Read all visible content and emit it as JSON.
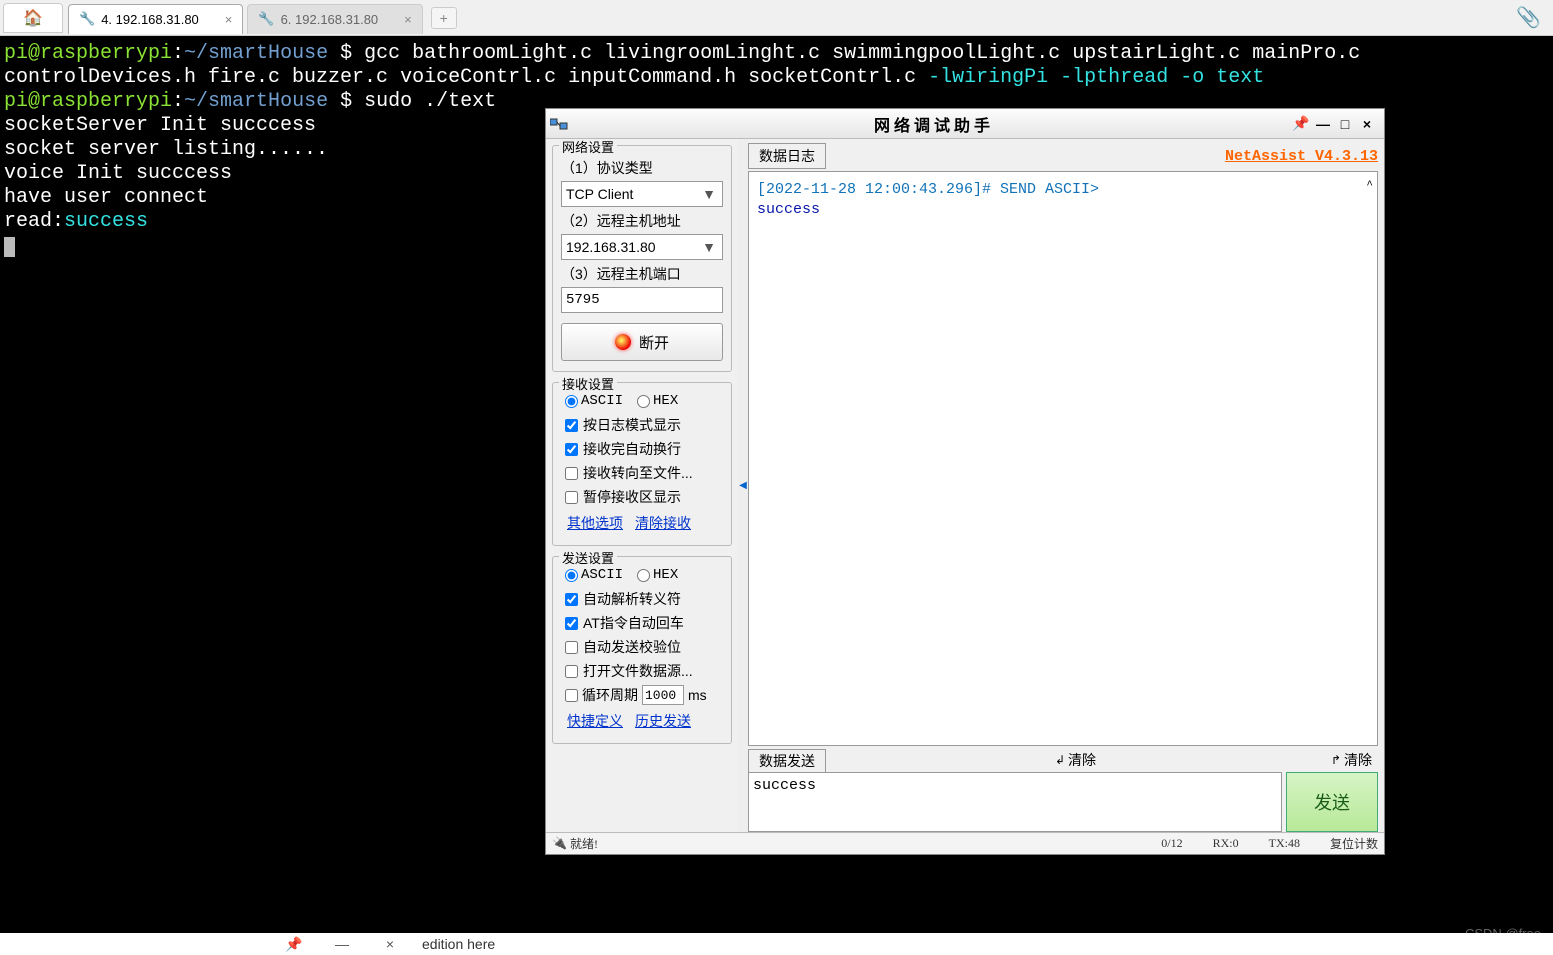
{
  "tabs": {
    "home_icon": "🏠",
    "tab1_icon": "🔧",
    "tab1_label": "4. 192.168.31.80",
    "tab1_close": "×",
    "tab2_icon": "🔧",
    "tab2_label": "6. 192.168.31.80",
    "tab2_close": "×",
    "plus": "+",
    "paperclip": "📎"
  },
  "terminal": {
    "prompt_user": "pi@raspberrypi",
    "prompt_sep": ":",
    "prompt_path": "~/smartHouse",
    "prompt_end": " $ ",
    "cmd1": "gcc bathroomLight.c livingroomLinght.c swimmingpoolLight.c upstairLight.c mainPro.c controlDevices.h fire.c buzzer.c voiceContrl.c inputCommand.h socketContrl.c ",
    "cmd1_flags": "-lwiringPi -lpthread  -o text",
    "cmd2": "sudo ./text",
    "out1": "socketServer Init succcess",
    "out2": "socket server listing......",
    "out3": "voice Init succcess",
    "out4": "have user connect",
    "out5_a": "read:",
    "out5_b": "success"
  },
  "netassist": {
    "title": "网络调试助手",
    "version": "NetAssist V4.3.13",
    "group_net": "网络设置",
    "label_protocol": "（1）协议类型",
    "select_protocol": "TCP Client",
    "label_host": "（2）远程主机地址",
    "input_host": "192.168.31.80",
    "label_port": "（3）远程主机端口",
    "input_port": "5795",
    "btn_disconnect": "断开",
    "group_recv": "接收设置",
    "radio_ascii": "ASCII",
    "radio_hex": "HEX",
    "chk_logmode": "按日志模式显示",
    "chk_autowrap": "接收完自动换行",
    "chk_tofile": "接收转向至文件...",
    "chk_pause": "暂停接收区显示",
    "link_other": "其他选项",
    "link_clear_recv": "清除接收",
    "group_send": "发送设置",
    "chk_escape": "自动解析转义符",
    "chk_at": "AT指令自动回车",
    "chk_checksum": "自动发送校验位",
    "chk_openfile": "打开文件数据源...",
    "chk_cycle": "循环周期",
    "cycle_value": "1000",
    "cycle_unit": "ms",
    "link_shortcut": "快捷定义",
    "link_history": "历史发送",
    "tab_log": "数据日志",
    "log_timestamp": "[2022-11-28 12:00:43.296]# SEND ASCII>",
    "log_msg": "success",
    "tab_send": "数据发送",
    "btn_clear_left": "清除",
    "btn_clear_right": "清除",
    "send_text": "success",
    "btn_send": "发送",
    "status_ready": "就绪!",
    "status_count": "0/12",
    "status_rx": "RX:0",
    "status_tx": "TX:48",
    "status_reset": "复位计数"
  },
  "taskbar": {
    "pin": "📌",
    "min": "—",
    "close": "×",
    "text": "edition here"
  },
  "watermark": "CSDN @free"
}
